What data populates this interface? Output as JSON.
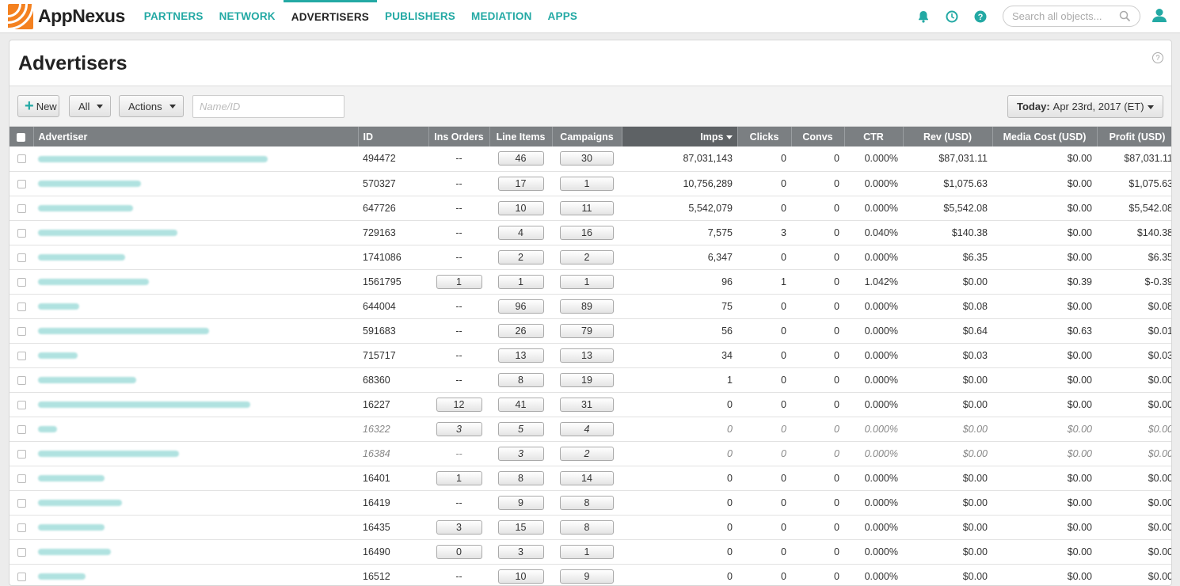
{
  "nav": {
    "brand": "AppNexus",
    "items": [
      "PARTNERS",
      "NETWORK",
      "ADVERTISERS",
      "PUBLISHERS",
      "MEDIATION",
      "APPS"
    ],
    "active": "ADVERTISERS",
    "search_placeholder": "Search all objects..."
  },
  "page": {
    "title": "Advertisers",
    "help": "?"
  },
  "toolbar": {
    "new_label": "New",
    "filter_label": "All",
    "actions_label": "Actions",
    "name_placeholder": "Name/ID",
    "date_prefix": "Today:",
    "date_value": "Apr 23rd, 2017 (ET)"
  },
  "table": {
    "columns": [
      "Advertiser",
      "ID",
      "Ins Orders",
      "Line Items",
      "Campaigns",
      "Imps",
      "Clicks",
      "Convs",
      "CTR",
      "Rev (USD)",
      "Media Cost (USD)",
      "Profit (USD)"
    ],
    "sorted_column": "Imps",
    "rows": [
      {
        "id": "494472",
        "io": "--",
        "li": "46",
        "camp": "30",
        "imps": "87,031,143",
        "clicks": "0",
        "convs": "0",
        "ctr": "0.000%",
        "rev": "$87,031.11",
        "media": "$0.00",
        "profit": "$87,031.11",
        "inactive": false,
        "blur_w": 290
      },
      {
        "id": "570327",
        "io": "--",
        "li": "17",
        "camp": "1",
        "imps": "10,756,289",
        "clicks": "0",
        "convs": "0",
        "ctr": "0.000%",
        "rev": "$1,075.63",
        "media": "$0.00",
        "profit": "$1,075.63",
        "inactive": false,
        "blur_w": 130
      },
      {
        "id": "647726",
        "io": "--",
        "li": "10",
        "camp": "11",
        "imps": "5,542,079",
        "clicks": "0",
        "convs": "0",
        "ctr": "0.000%",
        "rev": "$5,542.08",
        "media": "$0.00",
        "profit": "$5,542.08",
        "inactive": false,
        "blur_w": 120
      },
      {
        "id": "729163",
        "io": "--",
        "li": "4",
        "camp": "16",
        "imps": "7,575",
        "clicks": "3",
        "convs": "0",
        "ctr": "0.040%",
        "rev": "$140.38",
        "media": "$0.00",
        "profit": "$140.38",
        "inactive": false,
        "blur_w": 176
      },
      {
        "id": "1741086",
        "io": "--",
        "li": "2",
        "camp": "2",
        "imps": "6,347",
        "clicks": "0",
        "convs": "0",
        "ctr": "0.000%",
        "rev": "$6.35",
        "media": "$0.00",
        "profit": "$6.35",
        "inactive": false,
        "blur_w": 110
      },
      {
        "id": "1561795",
        "io": "1",
        "li": "1",
        "camp": "1",
        "imps": "96",
        "clicks": "1",
        "convs": "0",
        "ctr": "1.042%",
        "rev": "$0.00",
        "media": "$0.39",
        "profit": "$-0.39",
        "inactive": false,
        "blur_w": 140
      },
      {
        "id": "644004",
        "io": "--",
        "li": "96",
        "camp": "89",
        "imps": "75",
        "clicks": "0",
        "convs": "0",
        "ctr": "0.000%",
        "rev": "$0.08",
        "media": "$0.00",
        "profit": "$0.08",
        "inactive": false,
        "blur_w": 52
      },
      {
        "id": "591683",
        "io": "--",
        "li": "26",
        "camp": "79",
        "imps": "56",
        "clicks": "0",
        "convs": "0",
        "ctr": "0.000%",
        "rev": "$0.64",
        "media": "$0.63",
        "profit": "$0.01",
        "inactive": false,
        "blur_w": 216
      },
      {
        "id": "715717",
        "io": "--",
        "li": "13",
        "camp": "13",
        "imps": "34",
        "clicks": "0",
        "convs": "0",
        "ctr": "0.000%",
        "rev": "$0.03",
        "media": "$0.00",
        "profit": "$0.03",
        "inactive": false,
        "blur_w": 50
      },
      {
        "id": "68360",
        "io": "--",
        "li": "8",
        "camp": "19",
        "imps": "1",
        "clicks": "0",
        "convs": "0",
        "ctr": "0.000%",
        "rev": "$0.00",
        "media": "$0.00",
        "profit": "$0.00",
        "inactive": false,
        "blur_w": 124
      },
      {
        "id": "16227",
        "io": "12",
        "li": "41",
        "camp": "31",
        "imps": "0",
        "clicks": "0",
        "convs": "0",
        "ctr": "0.000%",
        "rev": "$0.00",
        "media": "$0.00",
        "profit": "$0.00",
        "inactive": false,
        "blur_w": 268
      },
      {
        "id": "16322",
        "io": "3",
        "li": "5",
        "camp": "4",
        "imps": "0",
        "clicks": "0",
        "convs": "0",
        "ctr": "0.000%",
        "rev": "$0.00",
        "media": "$0.00",
        "profit": "$0.00",
        "inactive": true,
        "blur_w": 24
      },
      {
        "id": "16384",
        "io": "--",
        "li": "3",
        "camp": "2",
        "imps": "0",
        "clicks": "0",
        "convs": "0",
        "ctr": "0.000%",
        "rev": "$0.00",
        "media": "$0.00",
        "profit": "$0.00",
        "inactive": true,
        "blur_w": 178
      },
      {
        "id": "16401",
        "io": "1",
        "li": "8",
        "camp": "14",
        "imps": "0",
        "clicks": "0",
        "convs": "0",
        "ctr": "0.000%",
        "rev": "$0.00",
        "media": "$0.00",
        "profit": "$0.00",
        "inactive": false,
        "blur_w": 84
      },
      {
        "id": "16419",
        "io": "--",
        "li": "9",
        "camp": "8",
        "imps": "0",
        "clicks": "0",
        "convs": "0",
        "ctr": "0.000%",
        "rev": "$0.00",
        "media": "$0.00",
        "profit": "$0.00",
        "inactive": false,
        "blur_w": 106
      },
      {
        "id": "16435",
        "io": "3",
        "li": "15",
        "camp": "8",
        "imps": "0",
        "clicks": "0",
        "convs": "0",
        "ctr": "0.000%",
        "rev": "$0.00",
        "media": "$0.00",
        "profit": "$0.00",
        "inactive": false,
        "blur_w": 84
      },
      {
        "id": "16490",
        "io": "0",
        "li": "3",
        "camp": "1",
        "imps": "0",
        "clicks": "0",
        "convs": "0",
        "ctr": "0.000%",
        "rev": "$0.00",
        "media": "$0.00",
        "profit": "$0.00",
        "inactive": false,
        "blur_w": 92
      },
      {
        "id": "16512",
        "io": "--",
        "li": "10",
        "camp": "9",
        "imps": "0",
        "clicks": "0",
        "convs": "0",
        "ctr": "0.000%",
        "rev": "$0.00",
        "media": "$0.00",
        "profit": "$0.00",
        "inactive": false,
        "blur_w": 60
      }
    ]
  },
  "colors": {
    "accent": "#23a9a4",
    "header_bg": "#7b7f82",
    "logo": "#f48120"
  }
}
